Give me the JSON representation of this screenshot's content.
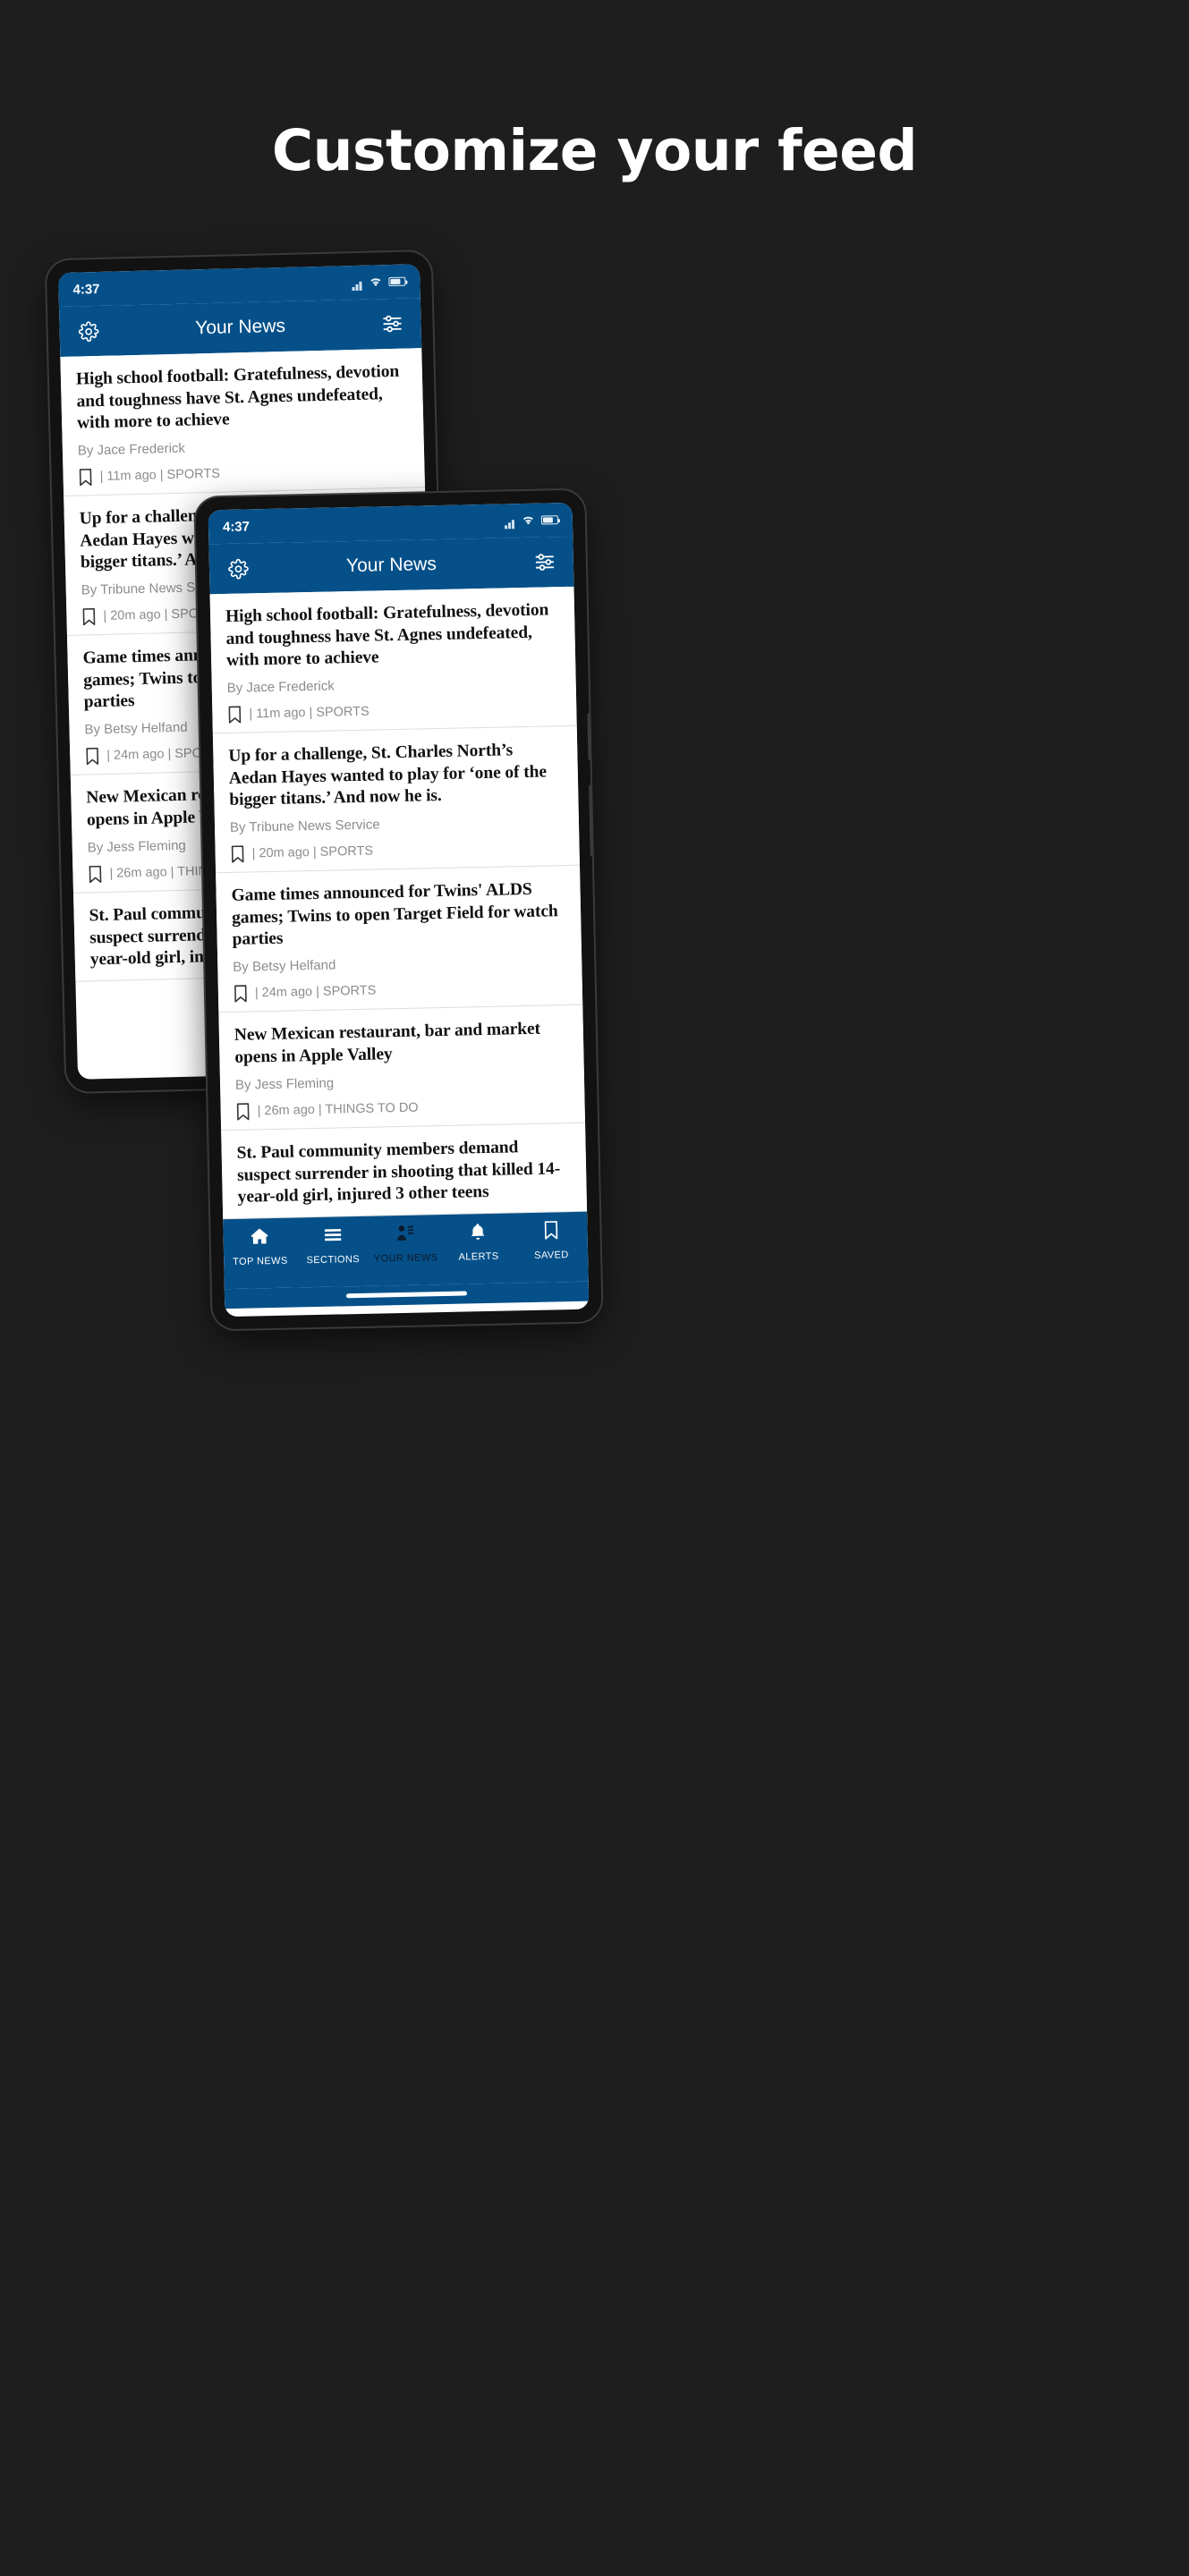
{
  "promo": {
    "title": "Customize your feed",
    "background_color": "#1e1e1e",
    "title_color": "#ffffff"
  },
  "theme": {
    "brand_blue": "#055089",
    "headline_color": "#111111",
    "byline_color": "#8c8c8c",
    "active_nav_color": "#0a1b2b"
  },
  "app": {
    "status_bar": {
      "time": "4:37",
      "icons": [
        "signal-icon",
        "wifi-icon",
        "battery-icon"
      ]
    },
    "app_bar": {
      "title": "Your News",
      "left_icon": "gear-icon",
      "right_icon": "sliders-icon"
    },
    "articles": [
      {
        "headline": "High school football: Gratefulness, devotion and toughness have St. Agnes undefeated, with more to achieve",
        "byline": "By Jace Frederick",
        "bookmark_icon": "bookmark-icon",
        "time": "11m ago",
        "section": "SPORTS",
        "separator": "|"
      },
      {
        "headline": "Up for a challenge, St. Charles North’s Aedan Hayes wanted to play for ‘one of the bigger titans.’ And now he is.",
        "byline": "By Tribune News Service",
        "bookmark_icon": "bookmark-icon",
        "time": "20m ago",
        "section": "SPORTS",
        "separator": "|"
      },
      {
        "headline": "Game times announced for Twins' ALDS games; Twins to open Target Field for watch parties",
        "byline": "By Betsy Helfand",
        "bookmark_icon": "bookmark-icon",
        "time": "24m ago",
        "section": "SPORTS",
        "separator": "|"
      },
      {
        "headline": "New Mexican restaurant, bar and market opens in Apple Valley",
        "byline": "By Jess Fleming",
        "bookmark_icon": "bookmark-icon",
        "time": "26m ago",
        "section": "THINGS TO DO",
        "separator": "|"
      },
      {
        "headline": "St. Paul community members demand suspect surrender in shooting that killed 14-year-old girl, injured 3 other teens",
        "byline": "",
        "bookmark_icon": "bookmark-icon",
        "time": "",
        "section": "",
        "separator": ""
      }
    ],
    "bottom_nav": [
      {
        "label": "TOP NEWS",
        "icon": "home-icon",
        "active": false
      },
      {
        "label": "SECTIONS",
        "icon": "hamburger-icon",
        "active": false
      },
      {
        "label": "YOUR NEWS",
        "icon": "person-list-icon",
        "active": true
      },
      {
        "label": "ALERTS",
        "icon": "bell-icon",
        "active": false
      },
      {
        "label": "SAVED",
        "icon": "bookmark-icon",
        "active": false
      }
    ]
  }
}
